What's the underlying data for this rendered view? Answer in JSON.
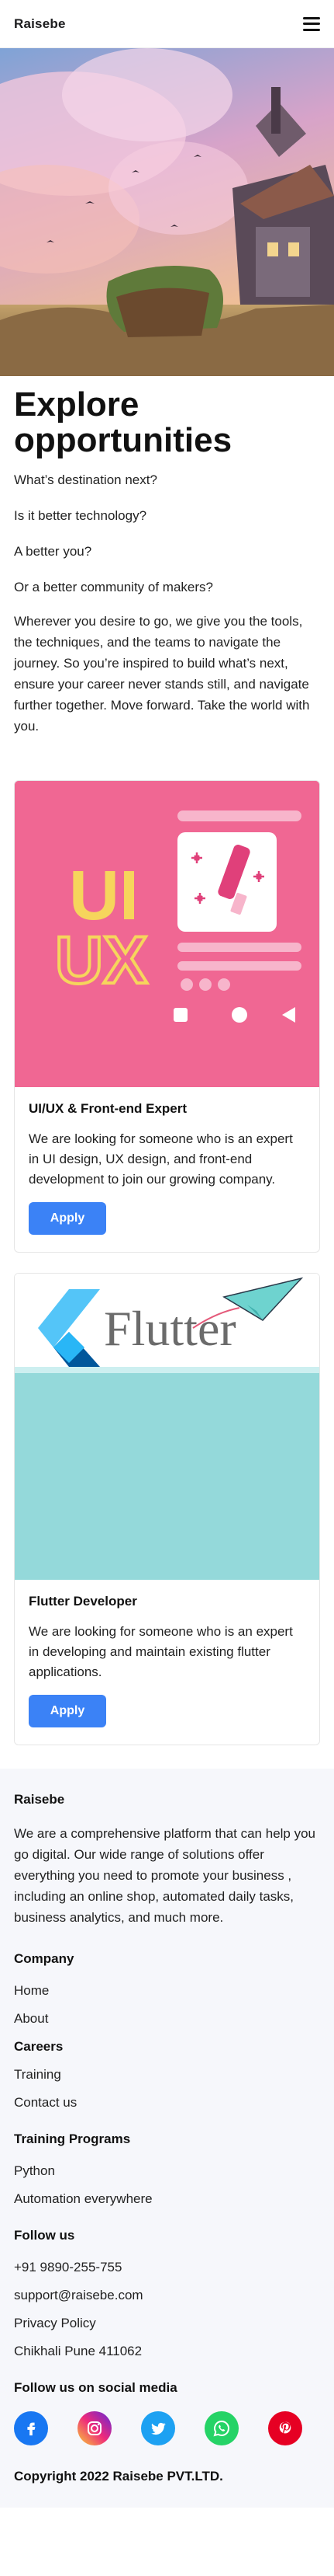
{
  "header": {
    "brand": "Raisebe",
    "menu_icon": "hamburger-menu-icon"
  },
  "hero": {
    "image": "illustrated-house-on-cliff"
  },
  "intro": {
    "title": "Explore opportunities",
    "questions": [
      "What’s destination next?",
      "Is it better technology?",
      "A better you?",
      "Or a better community of makers?"
    ],
    "body": "Wherever you desire to go, we give you the tools, the techniques, and the teams to navigate the journey. So you’re inspired to build what’s next, ensure your career never stands still, and navigate further together. Move forward. Take the world with you."
  },
  "jobs": [
    {
      "title": "UI/UX & Front-end Expert",
      "description": "We are looking for someone who is an expert in UI design, UX design, and front-end development to join our growing company.",
      "apply_label": "Apply",
      "media": {
        "bg": "#f06793",
        "word1": "UI",
        "word2": "UX",
        "accent": "#f6d55c"
      }
    },
    {
      "title": "Flutter Developer",
      "description": "We are looking for someone who is an expert in developing and maintain existing flutter applications.",
      "apply_label": "Apply",
      "media": {
        "word": "Flutter",
        "bg": "#94d9da"
      }
    }
  ],
  "footer": {
    "brand": "Raisebe",
    "about": "We are a comprehensive platform that can help you go digital. Our wide range of solutions offer everything you need to promote your business , including an online shop, automated daily tasks, business analytics, and much more.",
    "company_title": "Company",
    "company_links": [
      "Home",
      "About",
      "Careers",
      "Training",
      "Contact us"
    ],
    "training_title": "Training Programs",
    "training_links": [
      "Python",
      "Automation everywhere"
    ],
    "follow_title": "Follow us",
    "contact": [
      "+91 9890-255-755",
      "support@raisebe.com",
      "Privacy Policy",
      "Chikhali Pune 411062"
    ],
    "social_title": "Follow us on social media",
    "social": [
      {
        "name": "facebook-icon",
        "color": "#1877f2"
      },
      {
        "name": "instagram-icon",
        "color": "#c13584"
      },
      {
        "name": "twitter-icon",
        "color": "#1da1f2"
      },
      {
        "name": "whatsapp-icon",
        "color": "#25d366"
      },
      {
        "name": "pinterest-icon",
        "color": "#e60023"
      }
    ],
    "copyright": "Copyright 2022 Raisebe PVT.LTD."
  }
}
